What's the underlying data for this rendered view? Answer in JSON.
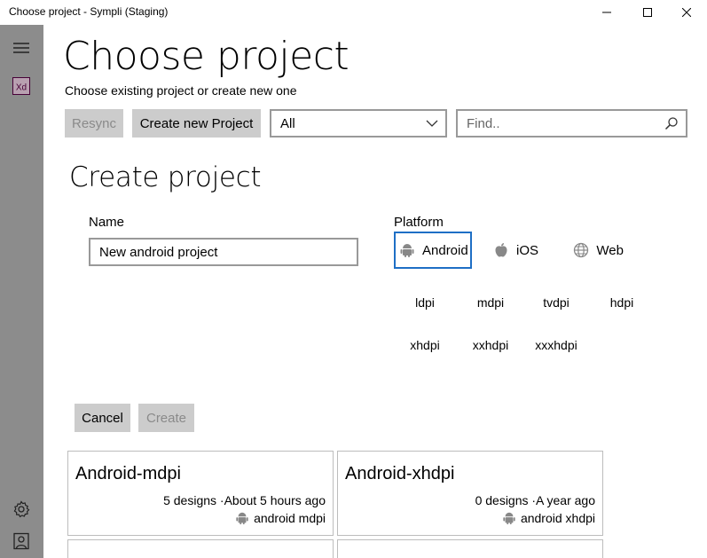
{
  "window": {
    "title": "Choose project - Sympli (Staging)"
  },
  "header": {
    "title": "Choose project",
    "subtitle": "Choose existing project or create new one"
  },
  "toolbar": {
    "resync_label": "Resync",
    "create_new_label": "Create new Project",
    "filter_value": "All",
    "search_placeholder": "Find.."
  },
  "create_form": {
    "title": "Create project",
    "name_label": "Name",
    "name_value": "New android project",
    "platform_label": "Platform",
    "platforms": [
      {
        "label": "Android",
        "icon": "android-icon",
        "selected": true
      },
      {
        "label": "iOS",
        "icon": "apple-icon",
        "selected": false
      },
      {
        "label": "Web",
        "icon": "globe-icon",
        "selected": false
      }
    ],
    "densities": [
      "ldpi",
      "mdpi",
      "tvdpi",
      "hdpi",
      "xhdpi",
      "xxhdpi",
      "xxxhdpi"
    ],
    "cancel_label": "Cancel",
    "create_label": "Create"
  },
  "projects": [
    {
      "name": "Android-mdpi",
      "meta": "5 designs ·About 5 hours ago",
      "platform": "android mdpi"
    },
    {
      "name": "Android-xhdpi",
      "meta": "0 designs ·A year ago",
      "platform": "android xhdpi"
    }
  ],
  "colors": {
    "rail": "#8c8c8c",
    "button": "#cccccc",
    "accent": "#1e6fc5",
    "xd_brand": "#470137"
  }
}
